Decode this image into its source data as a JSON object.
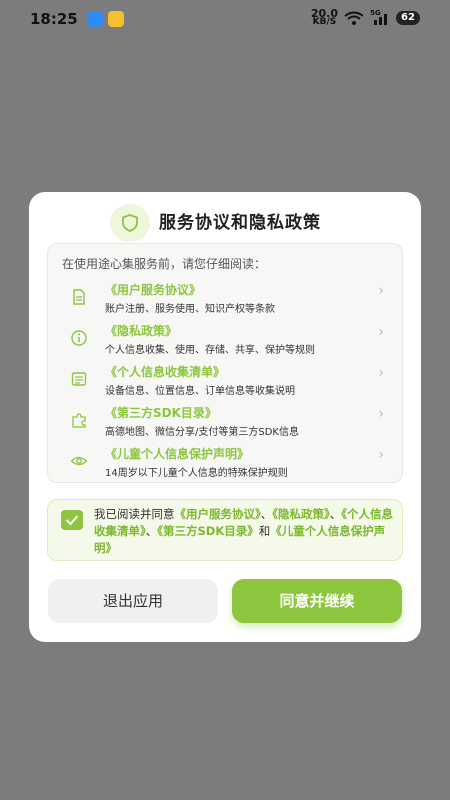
{
  "status_bar": {
    "time": "18:25",
    "net_speed_value": "20.0",
    "net_speed_unit": "KB/S",
    "network": "5G",
    "battery": "62",
    "icons": [
      "phone-app-icon",
      "mail-app-icon",
      "wifi-icon",
      "signal-icon",
      "battery-icon"
    ]
  },
  "dialog": {
    "title": "服务协议和隐私政策",
    "intro": "在使用途心集服务前，请您仔细阅读：",
    "items": [
      {
        "name": "《用户服务协议》",
        "desc": "账户注册、服务使用、知识产权等条款",
        "icon": "document-icon"
      },
      {
        "name": "《隐私政策》",
        "desc": "个人信息收集、使用、存储、共享、保护等规则",
        "icon": "info-icon"
      },
      {
        "name": "《个人信息收集清单》",
        "desc": "设备信息、位置信息、订单信息等收集说明",
        "icon": "list-icon"
      },
      {
        "name": "《第三方SDK目录》",
        "desc": "高德地图、微信分享/支付等第三方SDK信息",
        "icon": "puzzle-icon"
      },
      {
        "name": "《儿童个人信息保护声明》",
        "desc": "14周岁以下儿童个人信息的特殊保护规则",
        "icon": "eye-icon"
      }
    ],
    "consent": {
      "checked": true,
      "prefix": "我已阅读并同意",
      "link1": "《用户服务协议》",
      "sep1": "、",
      "link2": "《隐私政策》",
      "sep2": "、",
      "link3": "《个人信息收集清单》",
      "sep3": "、",
      "link4": "《第三方SDK目录》",
      "and": "和",
      "link5": "《儿童个人信息保护声明》"
    },
    "buttons": {
      "exit": "退出应用",
      "agree": "同意并继续"
    },
    "colors": {
      "accent": "#8cc63f",
      "overlay": "#7c7c7c"
    }
  }
}
